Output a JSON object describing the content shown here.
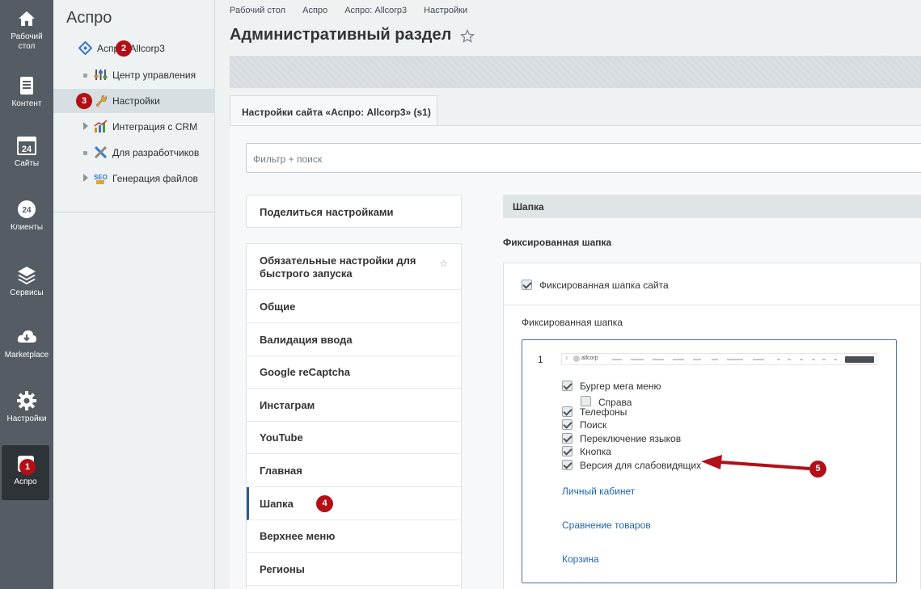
{
  "leftnav": {
    "items": [
      {
        "label": "Рабочий стол",
        "icon": "home-icon"
      },
      {
        "label": "Контент",
        "icon": "document-icon"
      },
      {
        "label": "Сайты",
        "icon": "calendar-icon"
      },
      {
        "label": "Клиенты",
        "icon": "clock-icon"
      },
      {
        "label": "Сервисы",
        "icon": "layers-icon"
      },
      {
        "label": "Marketplace",
        "icon": "cloud-download-icon"
      },
      {
        "label": "Настройки",
        "icon": "gear-icon"
      },
      {
        "label": "Аспро",
        "icon": "aspro-icon"
      }
    ],
    "badge": "1"
  },
  "panel2": {
    "title": "Аспро",
    "tree": [
      {
        "label": "Аспро: Allcorp3",
        "badge": "2"
      },
      {
        "label": "Центр управления"
      },
      {
        "label": "Настройки",
        "badge": "3"
      },
      {
        "label": "Интеграция с CRM"
      },
      {
        "label": "Для разработчиков"
      },
      {
        "label": "Генерация файлов"
      }
    ]
  },
  "breadcrumb": [
    "Рабочий стол",
    "Аспро",
    "Аспро: Allcorp3",
    "Настройки"
  ],
  "page_title": "Административный раздел",
  "tab_label": "Настройки сайта «Аспро: Allcorp3» (s1)",
  "filter_placeholder": "Фильтр + поиск",
  "share_label": "Поделиться настройками",
  "settings_list": [
    "Обязательные настройки для быстрого запуска",
    "Общие",
    "Валидация ввода",
    "Google reCaptcha",
    "Инстаграм",
    "YouTube",
    "Главная",
    "Шапка",
    "Верхнее меню",
    "Регионы"
  ],
  "settings_star": "☆",
  "list_badge": "4",
  "section": {
    "header": "Шапка",
    "subheader": "Фиксированная шапка",
    "fixed_checkbox_label": "Фиксированная шапка сайта",
    "variant_title": "Фиксированная шапка",
    "variant_number": "1",
    "preview_logo": "allcorp",
    "options": [
      {
        "label": "Бургер мега меню",
        "checked": true
      },
      {
        "label": "Справа",
        "checked": false
      },
      {
        "label": "Телефоны",
        "checked": true
      },
      {
        "label": "Поиск",
        "checked": true
      },
      {
        "label": "Переключение языков",
        "checked": true
      },
      {
        "label": "Кнопка",
        "checked": true
      },
      {
        "label": "Версия для слабовидящих",
        "checked": true
      }
    ],
    "links": [
      "Личный кабинет",
      "Сравнение товаров",
      "Корзина"
    ],
    "arrow_badge": "5"
  },
  "colors": {
    "badge": "#b30f16",
    "arrow": "#b30f16",
    "active_border": "#2f5b8f",
    "link": "#2067b0"
  }
}
